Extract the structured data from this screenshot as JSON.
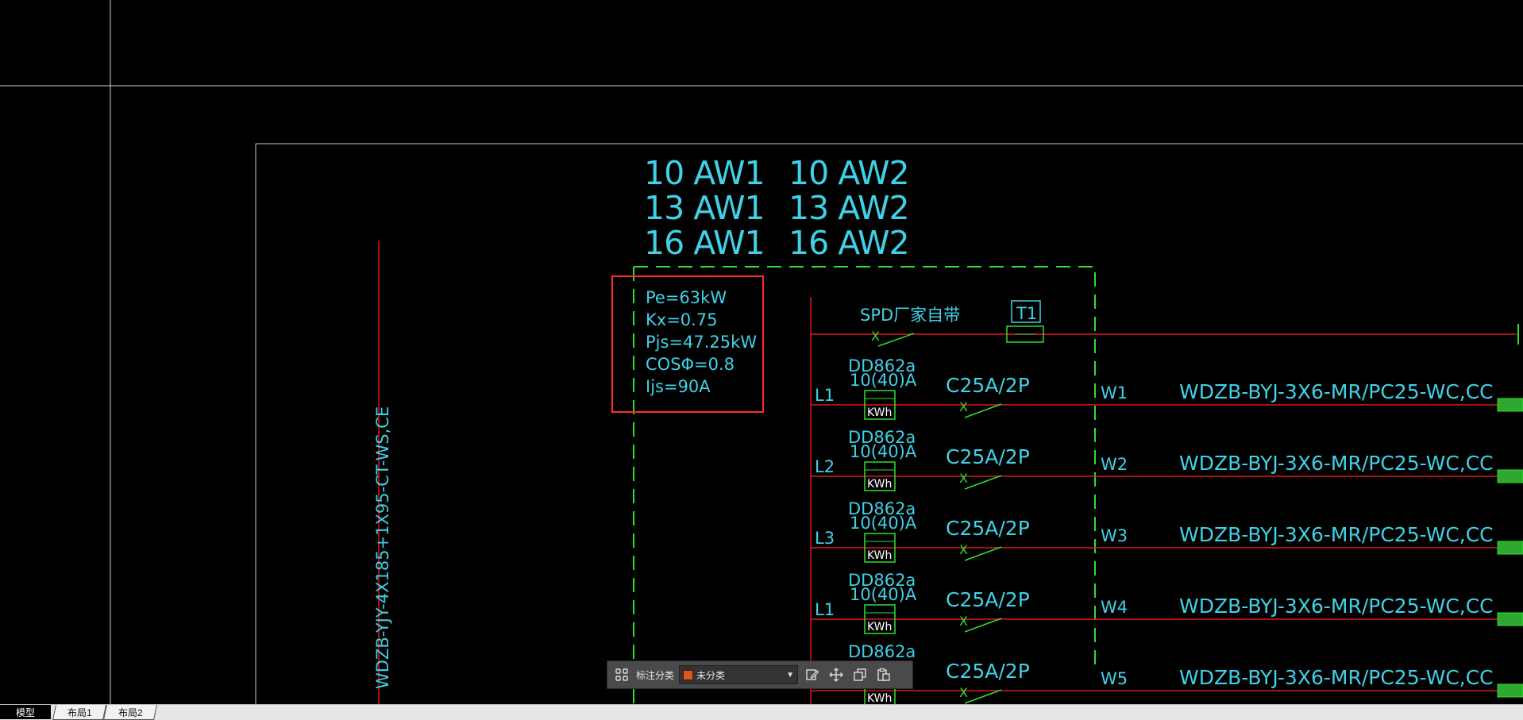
{
  "drawing": {
    "panel_names": [
      "10 AW1",
      "13 AW1",
      "16 AW1",
      "10 AW2",
      "13 AW2",
      "16 AW2"
    ],
    "load_calc": [
      "Pe=63kW",
      "Kx=0.75",
      "Pjs=47.25kW",
      "COSΦ=0.8",
      "Ijs=90A"
    ],
    "incoming_cable": "WDZB-YJY-4X185+1X95-CT-WS,CE",
    "spd_label": "SPD厂家自带",
    "t1_label": "T1",
    "circuits": [
      {
        "phase": "L1",
        "meter": "DD862a",
        "rating": "10(40)A",
        "kwh": "KWh",
        "breaker": "C25A/2P",
        "id": "W1",
        "cable": "WDZB-BYJ-3X6-MR/PC25-WC,CC"
      },
      {
        "phase": "L2",
        "meter": "DD862a",
        "rating": "10(40)A",
        "kwh": "KWh",
        "breaker": "C25A/2P",
        "id": "W2",
        "cable": "WDZB-BYJ-3X6-MR/PC25-WC,CC"
      },
      {
        "phase": "L3",
        "meter": "DD862a",
        "rating": "10(40)A",
        "kwh": "KWh",
        "breaker": "C25A/2P",
        "id": "W3",
        "cable": "WDZB-BYJ-3X6-MR/PC25-WC,CC"
      },
      {
        "phase": "L1",
        "meter": "DD862a",
        "rating": "10(40)A",
        "kwh": "KWh",
        "breaker": "C25A/2P",
        "id": "W4",
        "cable": "WDZB-BYJ-3X6-MR/PC25-WC,CC"
      },
      {
        "phase": "",
        "meter": "DD862a",
        "rating": "",
        "kwh": "KWh",
        "breaker": "C25A/2P",
        "id": "W5",
        "cable": "WDZB-BYJ-3X6-MR/PC25-WC,CC"
      }
    ]
  },
  "toolbar": {
    "category_label": "标注分类",
    "category_value": "未分类",
    "icons": [
      "grid-icon",
      "edit-icon",
      "move-icon",
      "copy-icon",
      "paste-icon"
    ]
  },
  "tabs": [
    "模型",
    "布局1",
    "布局2"
  ],
  "colors": {
    "background": "#000000",
    "cad_cyan": "#3fd1e6",
    "cad_red": "#e01919",
    "cad_green": "#2ee02e",
    "frame_white": "#ffffff",
    "highlight_box": "#ff2a2a"
  }
}
